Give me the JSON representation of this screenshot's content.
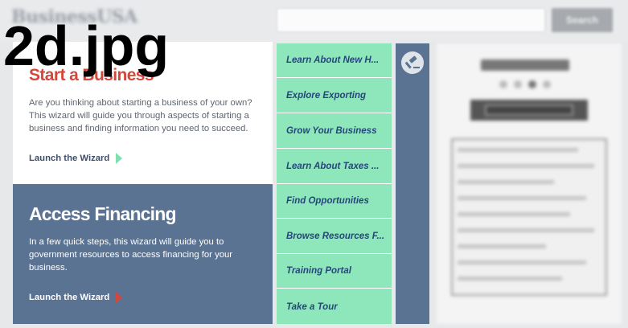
{
  "overlay": {
    "filename": "2d.jpg"
  },
  "header": {
    "brand": "BusinessUSA",
    "search_placeholder": "",
    "search_button": "Search"
  },
  "start_card": {
    "title": "Start a Business",
    "description": "Are you thinking about starting a business of your own? This wizard will guide you through aspects of starting a business and finding information you need to succeed.",
    "launch_label": "Launch the Wizard"
  },
  "finance_card": {
    "title": "Access Financing",
    "description": "In a few quick steps, this wizard will guide you to government resources to access financing for your business.",
    "launch_label": "Launch the Wizard"
  },
  "nav": {
    "items": [
      "Learn About New H...",
      "Explore Exporting",
      "Grow Your Business",
      "Learn About Taxes ...",
      "Find Opportunities",
      "Browse Resources F...",
      "Training Portal",
      "Take a Tour"
    ]
  },
  "colors": {
    "accent_red": "#d4473a",
    "nav_green": "#8ee7bb",
    "slate_blue": "#5b7393",
    "nav_text": "#25467a"
  }
}
